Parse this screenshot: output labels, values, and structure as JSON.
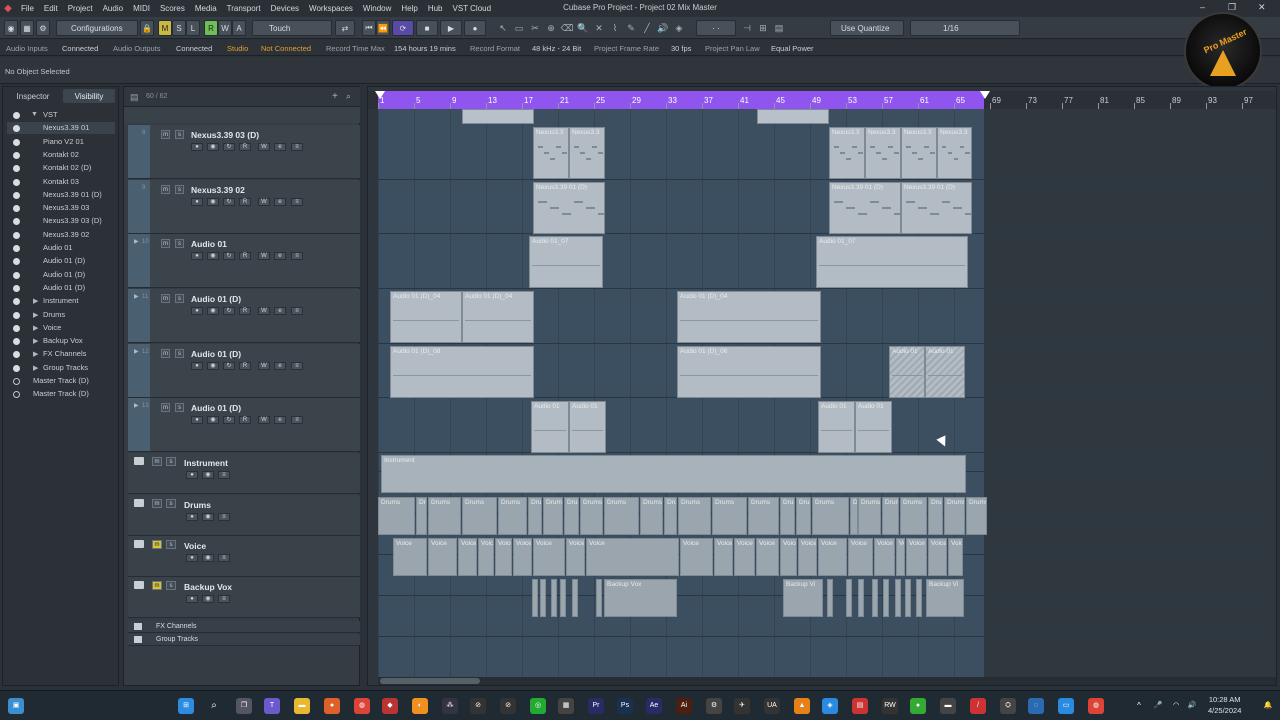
{
  "app": {
    "title": "Cubase Pro Project - Project 02 Mix Master"
  },
  "menu": [
    "File",
    "Edit",
    "Project",
    "Audio",
    "MIDI",
    "Scores",
    "Media",
    "Transport",
    "Devices",
    "Workspaces",
    "Window",
    "Help",
    "Hub",
    "VST Cloud"
  ],
  "toolbar": {
    "configurations_label": "Configurations",
    "mode_buttons": [
      "M",
      "S",
      "L",
      "R",
      "W",
      "A"
    ],
    "automation_mode": "Touch",
    "quantize_label": "Use Quantize",
    "quantize_value": "1/16"
  },
  "status": {
    "audio_inputs_label": "Audio Inputs",
    "audio_inputs_value": "Connected",
    "audio_outputs_label": "Audio Outputs",
    "audio_outputs_value": "Connected",
    "studio_label": "Studio",
    "studio_value": "Not Connected",
    "record_time_label": "Record Time Max",
    "record_time_value": "154 hours 19 mins",
    "record_format_label": "Record Format",
    "record_format_value": "48 kHz - 24 Bit",
    "frame_rate_label": "Project Frame Rate",
    "frame_rate_value": "30 fps",
    "pan_law_label": "Project Pan Law",
    "pan_law_value": "Equal Power"
  },
  "info_line": "No Object Selected",
  "left_zone": {
    "tabs": [
      "Inspector",
      "Visibility"
    ],
    "items": [
      {
        "label": "VST",
        "kind": "folder-open"
      },
      {
        "label": "Nexus3.39 01",
        "kind": "track"
      },
      {
        "label": "Piano V2 01",
        "kind": "track"
      },
      {
        "label": "Kontakt 02",
        "kind": "track"
      },
      {
        "label": "Kontakt 02 (D)",
        "kind": "track"
      },
      {
        "label": "Kontakt 03",
        "kind": "track"
      },
      {
        "label": "Nexus3.39 01 (D)",
        "kind": "track"
      },
      {
        "label": "Nexus3.39 03",
        "kind": "track"
      },
      {
        "label": "Nexus3.39 03 (D)",
        "kind": "track"
      },
      {
        "label": "Nexus3.39 02",
        "kind": "track"
      },
      {
        "label": "Audio 01",
        "kind": "track"
      },
      {
        "label": "Audio 01 (D)",
        "kind": "track"
      },
      {
        "label": "Audio 01 (D)",
        "kind": "track"
      },
      {
        "label": "Audio 01 (D)",
        "kind": "track"
      },
      {
        "label": "Instrument",
        "kind": "folder"
      },
      {
        "label": "Drums",
        "kind": "folder"
      },
      {
        "label": "Voice",
        "kind": "folder"
      },
      {
        "label": "Backup Vox",
        "kind": "folder"
      },
      {
        "label": "FX Channels",
        "kind": "folder"
      },
      {
        "label": "Group Tracks",
        "kind": "folder"
      },
      {
        "label": "Master Track (D)",
        "kind": "hollow"
      },
      {
        "label": "Master Track (D)",
        "kind": "hollow"
      }
    ]
  },
  "tracklist": {
    "counter": "60 / 62",
    "tracks": [
      {
        "num": "8",
        "name": "Nexus3.39 03 (D)"
      },
      {
        "num": "9",
        "name": "Nexus3.39 02"
      },
      {
        "num": "10",
        "name": "Audio 01"
      },
      {
        "num": "11",
        "name": "Audio 01 (D)"
      },
      {
        "num": "12",
        "name": "Audio 01 (D)"
      },
      {
        "num": "13",
        "name": "Audio 01 (D)"
      }
    ],
    "folders": [
      {
        "name": "Instrument"
      },
      {
        "name": "Drums"
      },
      {
        "name": "Voice"
      },
      {
        "name": "Backup Vox"
      }
    ],
    "bottom_folders": [
      "FX Channels",
      "Group Tracks"
    ]
  },
  "ruler": {
    "bars": [
      "1",
      "5",
      "9",
      "13",
      "17",
      "21",
      "25",
      "29",
      "33",
      "37",
      "41",
      "45",
      "49",
      "53",
      "57",
      "61",
      "65",
      "69",
      "73",
      "77",
      "81",
      "85",
      "89",
      "93",
      "97"
    ]
  },
  "parts": {
    "nexus03_a": "Nexus3.3",
    "nexus03_b": "Nexus3.3",
    "nexus02": "Nexus3.39 01 (D)",
    "audio01": "Audio 01_07",
    "audio01d_04": "Audio 01 (D)_04",
    "audio01d_08": "Audio 01 (D)_08",
    "audio01d_06": "Audio 01 (D)_06",
    "audio01d_short": "Audio 01",
    "instrument": "Instrument",
    "drums": "Drums",
    "voice": "Voice",
    "backup": "Backup Vox",
    "backup_short": "Backup Vi"
  },
  "clock": {
    "time": "10:28 AM",
    "date": "4/25/2024"
  },
  "logo_text": "Pro Master"
}
